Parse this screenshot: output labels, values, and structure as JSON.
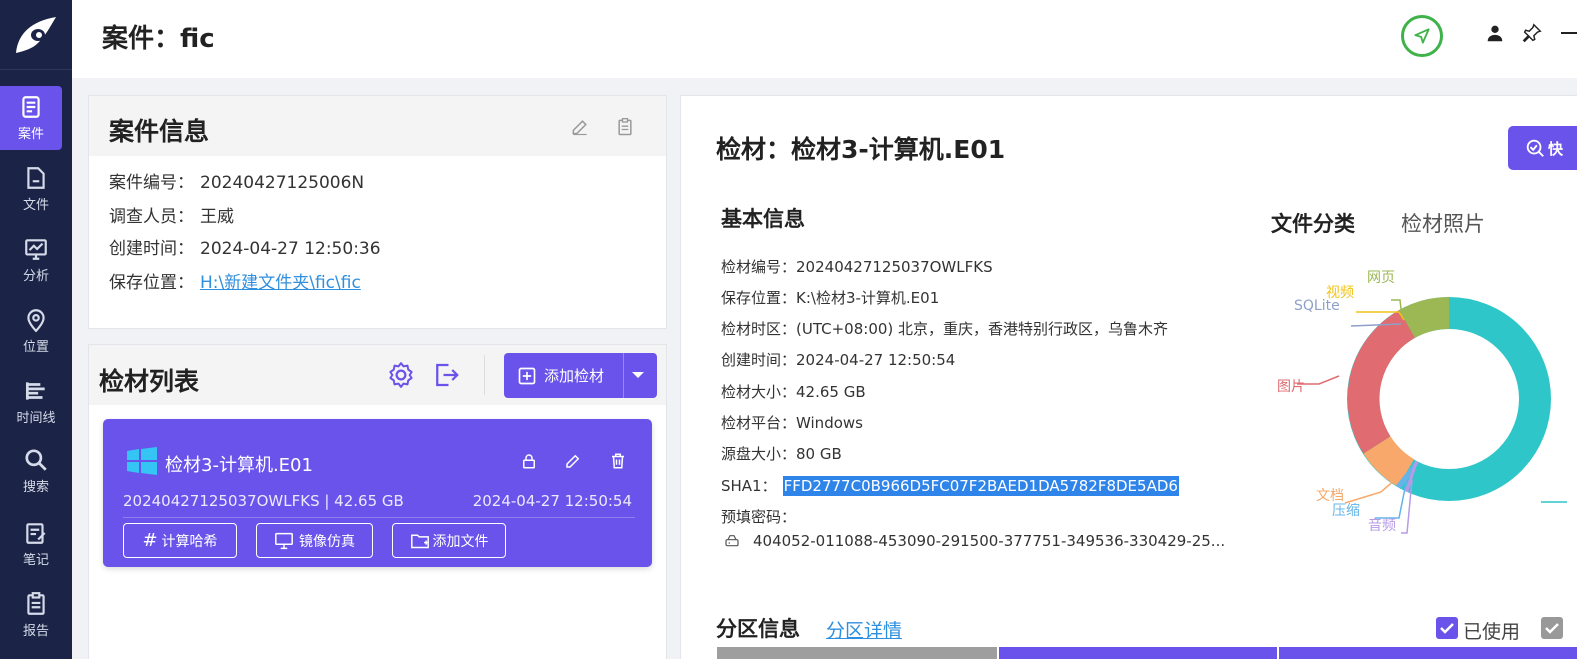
{
  "header": {
    "title": "案件：fic"
  },
  "sidebar": {
    "items": [
      {
        "label": "案件",
        "icon": "case-icon"
      },
      {
        "label": "文件",
        "icon": "file-icon"
      },
      {
        "label": "分析",
        "icon": "analysis-icon"
      },
      {
        "label": "位置",
        "icon": "location-icon"
      },
      {
        "label": "时间线",
        "icon": "timeline-icon"
      },
      {
        "label": "搜索",
        "icon": "search-icon"
      },
      {
        "label": "笔记",
        "icon": "notes-icon"
      },
      {
        "label": "报告",
        "icon": "report-icon"
      }
    ]
  },
  "case_info": {
    "title": "案件信息",
    "rows": [
      {
        "label": "案件编号：",
        "value": "20240427125006N"
      },
      {
        "label": "调查人员：",
        "value": "王威"
      },
      {
        "label": "创建时间：",
        "value": "2024-04-27 12:50:36"
      },
      {
        "label": "保存位置：",
        "value": "H:\\新建文件夹\\fic\\fic"
      }
    ]
  },
  "evidence_list": {
    "title": "检材列表",
    "add_label": "添加检材",
    "item": {
      "name": "检材3-计算机.E01",
      "meta": "20240427125037OWLFKS | 42.65 GB",
      "time": "2024-04-27 12:50:54",
      "btn_hash": "计算哈希",
      "btn_mirror": "镜像仿真",
      "btn_addfile": "添加文件"
    }
  },
  "detail": {
    "title": "检材：检材3-计算机.E01",
    "quick_btn": "快",
    "basic_title": "基本信息",
    "rows": [
      {
        "label": "检材编号：",
        "value": "20240427125037OWLFKS"
      },
      {
        "label": "保存位置：",
        "value": "K:\\检材3-计算机.E01"
      },
      {
        "label": "检材时区：",
        "value": "(UTC+08:00) 北京，重庆，香港特别行政区，乌鲁木齐"
      },
      {
        "label": "创建时间：",
        "value": "2024-04-27 12:50:54"
      },
      {
        "label": "检材大小：",
        "value": "42.65 GB"
      },
      {
        "label": "检材平台：",
        "value": "Windows"
      },
      {
        "label": "源盘大小：",
        "value": "80 GB"
      }
    ],
    "sha_label": "SHA1：",
    "sha_value": "FFD2777C0B966D5FC07F2BAED1DA5782F8DE5AD6",
    "pwd_label": "预填密码：",
    "pwd_value": "404052-011088-453090-291500-377751-349536-330429-25...",
    "tab_classify": "文件分类",
    "tab_photo": "检材照片",
    "partition_title": "分区信息",
    "partition_link": "分区详情",
    "used_label": "已使用"
  },
  "chart_data": {
    "type": "pie",
    "variant": "donut",
    "categories": [
      "网页",
      "视频",
      "SQLite",
      "图片",
      "文档",
      "压缩",
      "音频"
    ],
    "colors": [
      "#9bb855",
      "#f0c419",
      "#8e9fc9",
      "#e06b70",
      "#f7a86a",
      "#64b4e8",
      "#b79ae8"
    ],
    "accent_main": "#2ec6c8"
  }
}
